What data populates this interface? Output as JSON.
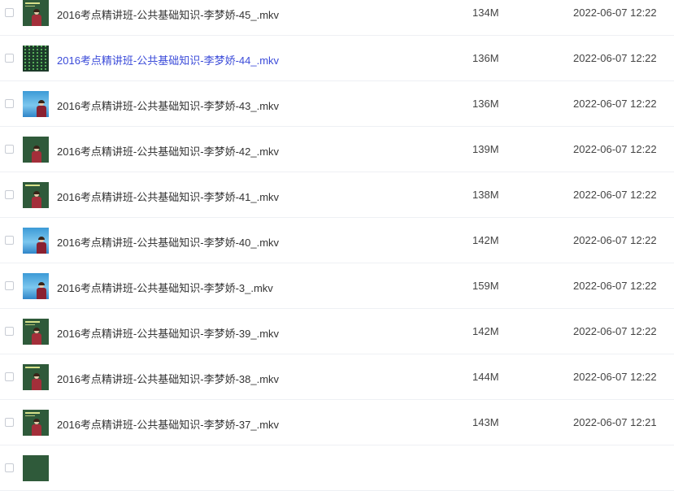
{
  "files": [
    {
      "name": "2016考点精讲班-公共基础知识-李梦娇-45_.mkv",
      "size": "134M",
      "date": "2022-06-07 12:22",
      "thumb": "green",
      "active": false
    },
    {
      "name": "2016考点精讲班-公共基础知识-李梦娇-44_.mkv",
      "size": "136M",
      "date": "2022-06-07 12:22",
      "thumb": "matrix",
      "active": true
    },
    {
      "name": "2016考点精讲班-公共基础知识-李梦娇-43_.mkv",
      "size": "136M",
      "date": "2022-06-07 12:22",
      "thumb": "blue",
      "active": false
    },
    {
      "name": "2016考点精讲班-公共基础知识-李梦娇-42_.mkv",
      "size": "139M",
      "date": "2022-06-07 12:22",
      "thumb": "green",
      "active": false
    },
    {
      "name": "2016考点精讲班-公共基础知识-李梦娇-41_.mkv",
      "size": "138M",
      "date": "2022-06-07 12:22",
      "thumb": "green",
      "active": false
    },
    {
      "name": "2016考点精讲班-公共基础知识-李梦娇-40_.mkv",
      "size": "142M",
      "date": "2022-06-07 12:22",
      "thumb": "blue",
      "active": false
    },
    {
      "name": "2016考点精讲班-公共基础知识-李梦娇-3_.mkv",
      "size": "159M",
      "date": "2022-06-07 12:22",
      "thumb": "blue",
      "active": false
    },
    {
      "name": "2016考点精讲班-公共基础知识-李梦娇-39_.mkv",
      "size": "142M",
      "date": "2022-06-07 12:22",
      "thumb": "green",
      "active": false
    },
    {
      "name": "2016考点精讲班-公共基础知识-李梦娇-38_.mkv",
      "size": "144M",
      "date": "2022-06-07 12:22",
      "thumb": "green",
      "active": false
    },
    {
      "name": "2016考点精讲班-公共基础知识-李梦娇-37_.mkv",
      "size": "143M",
      "date": "2022-06-07 12:21",
      "thumb": "green",
      "active": false
    },
    {
      "name": "",
      "size": "",
      "date": "",
      "thumb": "green",
      "active": false
    }
  ],
  "colors": {
    "link_active": "#3b4bd9",
    "divider": "#eef0f4",
    "thumb_green": "#2f5a3a"
  }
}
